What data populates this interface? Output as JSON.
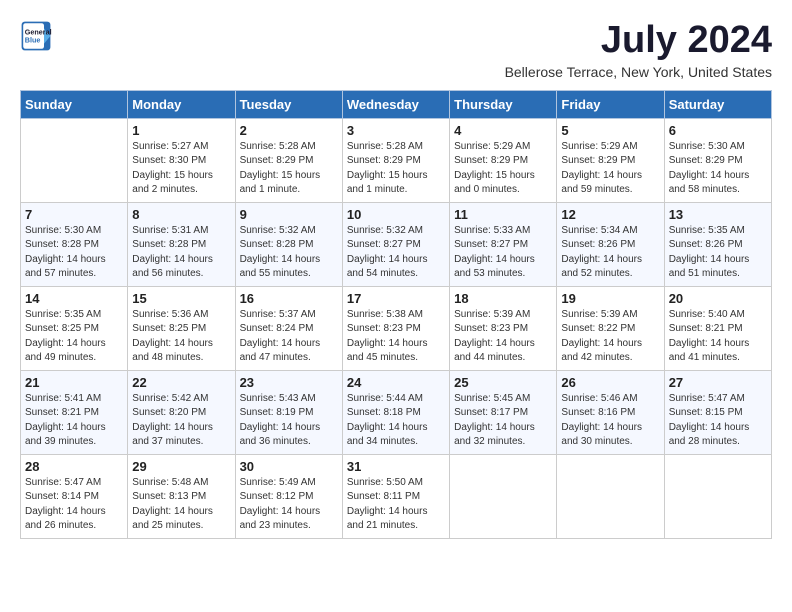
{
  "header": {
    "logo_line1": "General",
    "logo_line2": "Blue",
    "month_title": "July 2024",
    "location": "Bellerose Terrace, New York, United States"
  },
  "days_of_week": [
    "Sunday",
    "Monday",
    "Tuesday",
    "Wednesday",
    "Thursday",
    "Friday",
    "Saturday"
  ],
  "weeks": [
    [
      {
        "day": "",
        "info": ""
      },
      {
        "day": "1",
        "info": "Sunrise: 5:27 AM\nSunset: 8:30 PM\nDaylight: 15 hours\nand 2 minutes."
      },
      {
        "day": "2",
        "info": "Sunrise: 5:28 AM\nSunset: 8:29 PM\nDaylight: 15 hours\nand 1 minute."
      },
      {
        "day": "3",
        "info": "Sunrise: 5:28 AM\nSunset: 8:29 PM\nDaylight: 15 hours\nand 1 minute."
      },
      {
        "day": "4",
        "info": "Sunrise: 5:29 AM\nSunset: 8:29 PM\nDaylight: 15 hours\nand 0 minutes."
      },
      {
        "day": "5",
        "info": "Sunrise: 5:29 AM\nSunset: 8:29 PM\nDaylight: 14 hours\nand 59 minutes."
      },
      {
        "day": "6",
        "info": "Sunrise: 5:30 AM\nSunset: 8:29 PM\nDaylight: 14 hours\nand 58 minutes."
      }
    ],
    [
      {
        "day": "7",
        "info": "Sunrise: 5:30 AM\nSunset: 8:28 PM\nDaylight: 14 hours\nand 57 minutes."
      },
      {
        "day": "8",
        "info": "Sunrise: 5:31 AM\nSunset: 8:28 PM\nDaylight: 14 hours\nand 56 minutes."
      },
      {
        "day": "9",
        "info": "Sunrise: 5:32 AM\nSunset: 8:28 PM\nDaylight: 14 hours\nand 55 minutes."
      },
      {
        "day": "10",
        "info": "Sunrise: 5:32 AM\nSunset: 8:27 PM\nDaylight: 14 hours\nand 54 minutes."
      },
      {
        "day": "11",
        "info": "Sunrise: 5:33 AM\nSunset: 8:27 PM\nDaylight: 14 hours\nand 53 minutes."
      },
      {
        "day": "12",
        "info": "Sunrise: 5:34 AM\nSunset: 8:26 PM\nDaylight: 14 hours\nand 52 minutes."
      },
      {
        "day": "13",
        "info": "Sunrise: 5:35 AM\nSunset: 8:26 PM\nDaylight: 14 hours\nand 51 minutes."
      }
    ],
    [
      {
        "day": "14",
        "info": "Sunrise: 5:35 AM\nSunset: 8:25 PM\nDaylight: 14 hours\nand 49 minutes."
      },
      {
        "day": "15",
        "info": "Sunrise: 5:36 AM\nSunset: 8:25 PM\nDaylight: 14 hours\nand 48 minutes."
      },
      {
        "day": "16",
        "info": "Sunrise: 5:37 AM\nSunset: 8:24 PM\nDaylight: 14 hours\nand 47 minutes."
      },
      {
        "day": "17",
        "info": "Sunrise: 5:38 AM\nSunset: 8:23 PM\nDaylight: 14 hours\nand 45 minutes."
      },
      {
        "day": "18",
        "info": "Sunrise: 5:39 AM\nSunset: 8:23 PM\nDaylight: 14 hours\nand 44 minutes."
      },
      {
        "day": "19",
        "info": "Sunrise: 5:39 AM\nSunset: 8:22 PM\nDaylight: 14 hours\nand 42 minutes."
      },
      {
        "day": "20",
        "info": "Sunrise: 5:40 AM\nSunset: 8:21 PM\nDaylight: 14 hours\nand 41 minutes."
      }
    ],
    [
      {
        "day": "21",
        "info": "Sunrise: 5:41 AM\nSunset: 8:21 PM\nDaylight: 14 hours\nand 39 minutes."
      },
      {
        "day": "22",
        "info": "Sunrise: 5:42 AM\nSunset: 8:20 PM\nDaylight: 14 hours\nand 37 minutes."
      },
      {
        "day": "23",
        "info": "Sunrise: 5:43 AM\nSunset: 8:19 PM\nDaylight: 14 hours\nand 36 minutes."
      },
      {
        "day": "24",
        "info": "Sunrise: 5:44 AM\nSunset: 8:18 PM\nDaylight: 14 hours\nand 34 minutes."
      },
      {
        "day": "25",
        "info": "Sunrise: 5:45 AM\nSunset: 8:17 PM\nDaylight: 14 hours\nand 32 minutes."
      },
      {
        "day": "26",
        "info": "Sunrise: 5:46 AM\nSunset: 8:16 PM\nDaylight: 14 hours\nand 30 minutes."
      },
      {
        "day": "27",
        "info": "Sunrise: 5:47 AM\nSunset: 8:15 PM\nDaylight: 14 hours\nand 28 minutes."
      }
    ],
    [
      {
        "day": "28",
        "info": "Sunrise: 5:47 AM\nSunset: 8:14 PM\nDaylight: 14 hours\nand 26 minutes."
      },
      {
        "day": "29",
        "info": "Sunrise: 5:48 AM\nSunset: 8:13 PM\nDaylight: 14 hours\nand 25 minutes."
      },
      {
        "day": "30",
        "info": "Sunrise: 5:49 AM\nSunset: 8:12 PM\nDaylight: 14 hours\nand 23 minutes."
      },
      {
        "day": "31",
        "info": "Sunrise: 5:50 AM\nSunset: 8:11 PM\nDaylight: 14 hours\nand 21 minutes."
      },
      {
        "day": "",
        "info": ""
      },
      {
        "day": "",
        "info": ""
      },
      {
        "day": "",
        "info": ""
      }
    ]
  ]
}
